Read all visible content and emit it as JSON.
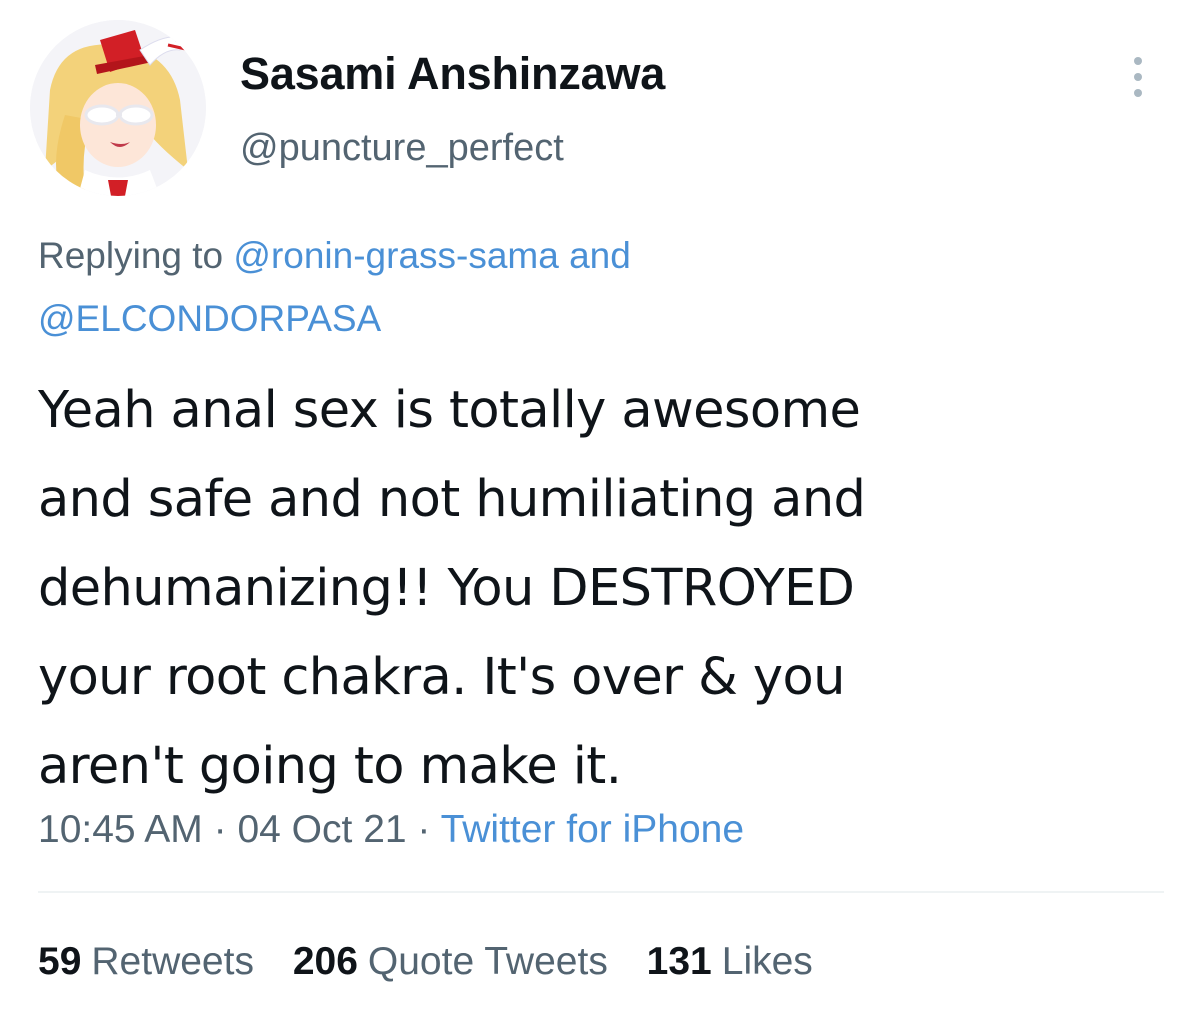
{
  "tweet": {
    "author": {
      "display_name": "Sasami Anshinzawa",
      "handle": "@puncture_perfect",
      "avatar": "anime-character-avatar"
    },
    "more_icon": "more-vertical-icon",
    "reply": {
      "prefix": "Replying to",
      "mention_1": "@ronin-grass-sama",
      "connector": "and",
      "mention_2": "@ELCONDORPASA"
    },
    "text_lines": [
      "Yeah anal sex is totally awesome",
      "and safe and not humiliating and",
      "dehumanizing!! You DESTROYED",
      "your root chakra. It's over & you",
      "aren't going to make it."
    ],
    "meta": {
      "time": "10:45 AM",
      "separator": "·",
      "date": "04 Oct 21",
      "source": "Twitter for iPhone"
    },
    "stats": {
      "retweets": {
        "count": "59",
        "label": "Retweets"
      },
      "quote_tweets": {
        "count": "206",
        "label": "Quote Tweets"
      },
      "likes": {
        "count": "131",
        "label": "Likes"
      }
    }
  },
  "colors": {
    "text_primary": "#0f1419",
    "text_secondary": "#536471",
    "link": "#4a90d6",
    "divider": "#eff3f4"
  }
}
